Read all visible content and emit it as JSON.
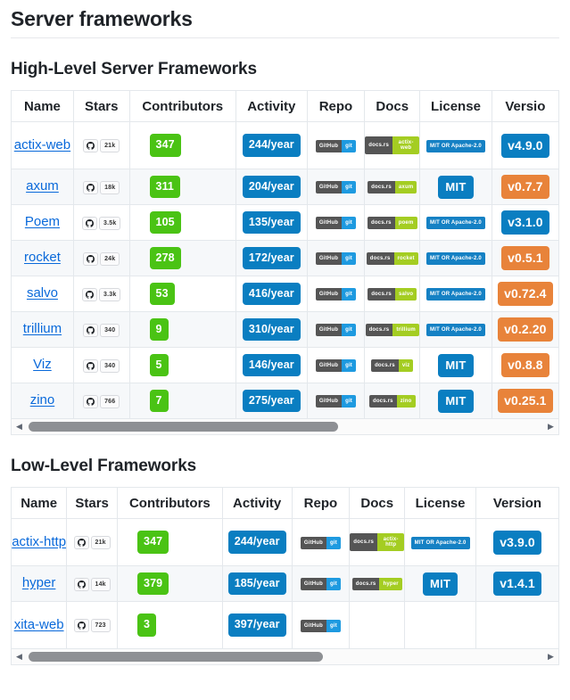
{
  "page": {
    "title": "Server frameworks"
  },
  "icons": {
    "github": "github-octocat-icon",
    "scroll_left": "◀",
    "scroll_right": "▶"
  },
  "sections": [
    {
      "id": "high-level",
      "heading": "High-Level Server Frameworks",
      "columns": [
        "Name",
        "Stars",
        "Contributors",
        "Activity",
        "Repo",
        "Docs",
        "License",
        "Versio"
      ],
      "scrollbar": {
        "thumb_percent": 60,
        "left_label": "scroll-left",
        "right_label": "scroll-right"
      },
      "rows": [
        {
          "name": "actix-web",
          "stars": "21k",
          "contributors": "347",
          "activity": "244/year",
          "repo": {
            "left": "GitHub",
            "right": "git"
          },
          "docs": {
            "left": "docs.rs",
            "right": "actix-web"
          },
          "license": {
            "text": "MIT OR Apache-2.0",
            "style": "small"
          },
          "version": {
            "text": "v4.9.0",
            "color": "blue"
          }
        },
        {
          "name": "axum",
          "stars": "18k",
          "contributors": "311",
          "activity": "204/year",
          "repo": {
            "left": "GitHub",
            "right": "git"
          },
          "docs": {
            "left": "docs.rs",
            "right": "axum"
          },
          "license": {
            "text": "MIT",
            "style": "large"
          },
          "version": {
            "text": "v0.7.7",
            "color": "orange"
          }
        },
        {
          "name": "Poem",
          "stars": "3.5k",
          "contributors": "105",
          "activity": "135/year",
          "repo": {
            "left": "GitHub",
            "right": "git"
          },
          "docs": {
            "left": "docs.rs",
            "right": "poem"
          },
          "license": {
            "text": "MIT OR Apache-2.0",
            "style": "small"
          },
          "version": {
            "text": "v3.1.0",
            "color": "blue"
          }
        },
        {
          "name": "rocket",
          "stars": "24k",
          "contributors": "278",
          "activity": "172/year",
          "repo": {
            "left": "GitHub",
            "right": "git"
          },
          "docs": {
            "left": "docs.rs",
            "right": "rocket"
          },
          "license": {
            "text": "MIT OR Apache-2.0",
            "style": "small"
          },
          "version": {
            "text": "v0.5.1",
            "color": "orange"
          }
        },
        {
          "name": "salvo",
          "stars": "3.3k",
          "contributors": "53",
          "activity": "416/year",
          "repo": {
            "left": "GitHub",
            "right": "git"
          },
          "docs": {
            "left": "docs.rs",
            "right": "salvo"
          },
          "license": {
            "text": "MIT OR Apache-2.0",
            "style": "small"
          },
          "version": {
            "text": "v0.72.4",
            "color": "orange"
          }
        },
        {
          "name": "trillium",
          "stars": "340",
          "contributors": "9",
          "activity": "310/year",
          "repo": {
            "left": "GitHub",
            "right": "git"
          },
          "docs": {
            "left": "docs.rs",
            "right": "trillium"
          },
          "license": {
            "text": "MIT OR Apache-2.0",
            "style": "small"
          },
          "version": {
            "text": "v0.2.20",
            "color": "orange"
          }
        },
        {
          "name": "Viz",
          "stars": "340",
          "contributors": "5",
          "activity": "146/year",
          "repo": {
            "left": "GitHub",
            "right": "git"
          },
          "docs": {
            "left": "docs.rs",
            "right": "viz"
          },
          "license": {
            "text": "MIT",
            "style": "large"
          },
          "version": {
            "text": "v0.8.8",
            "color": "orange"
          }
        },
        {
          "name": "zino",
          "stars": "766",
          "contributors": "7",
          "activity": "275/year",
          "repo": {
            "left": "GitHub",
            "right": "git"
          },
          "docs": {
            "left": "docs.rs",
            "right": "zino"
          },
          "license": {
            "text": "MIT",
            "style": "large"
          },
          "version": {
            "text": "v0.25.1",
            "color": "orange"
          }
        }
      ]
    },
    {
      "id": "low-level",
      "heading": "Low-Level Frameworks",
      "columns": [
        "Name",
        "Stars",
        "Contributors",
        "Activity",
        "Repo",
        "Docs",
        "License",
        "Version"
      ],
      "scrollbar": {
        "thumb_percent": 57,
        "left_label": "scroll-left",
        "right_label": "scroll-right"
      },
      "rows": [
        {
          "name": "actix-http",
          "stars": "21k",
          "contributors": "347",
          "activity": "244/year",
          "repo": {
            "left": "GitHub",
            "right": "git"
          },
          "docs": {
            "left": "docs.rs",
            "right": "actix-http"
          },
          "license": {
            "text": "MIT OR Apache-2.0",
            "style": "small"
          },
          "version": {
            "text": "v3.9.0",
            "color": "blue"
          }
        },
        {
          "name": "hyper",
          "stars": "14k",
          "contributors": "379",
          "activity": "185/year",
          "repo": {
            "left": "GitHub",
            "right": "git"
          },
          "docs": {
            "left": "docs.rs",
            "right": "hyper"
          },
          "license": {
            "text": "MIT",
            "style": "large"
          },
          "version": {
            "text": "v1.4.1",
            "color": "blue"
          }
        },
        {
          "name": "xita-web",
          "stars": "723",
          "contributors": "3",
          "activity": "397/year",
          "repo": {
            "left": "GitHub",
            "right": "git"
          },
          "docs": null,
          "license": null,
          "version": null
        }
      ]
    }
  ]
}
